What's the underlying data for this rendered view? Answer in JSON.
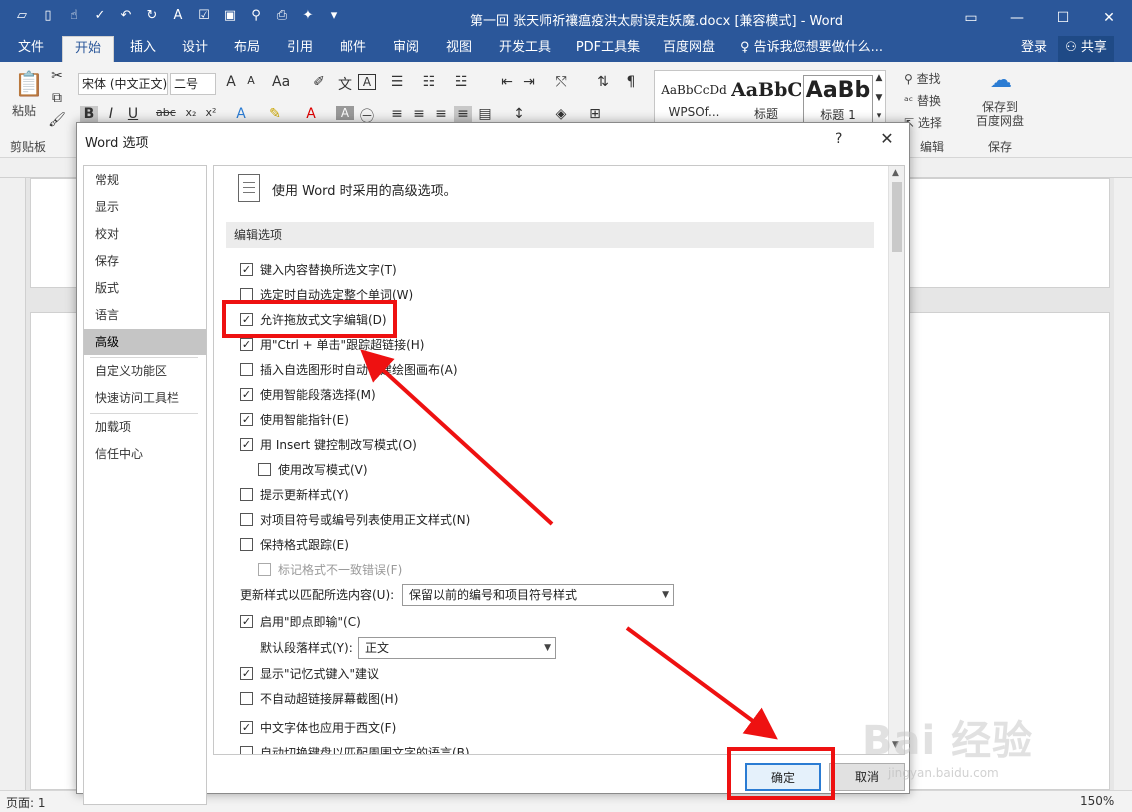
{
  "window": {
    "title": "第一回 张天师祈禳瘟疫洪太尉误走妖魔.docx [兼容模式] - Word",
    "controls": [
      "restore-ribbon-icon",
      "minimize-icon",
      "maximize-icon",
      "close-icon"
    ]
  },
  "quick_access": [
    "folder-icon",
    "new-document-icon",
    "touch-mode-icon",
    "spelling-icon",
    "undo-icon",
    "redo-icon",
    "font-size-icon",
    "checkbox-icon",
    "save-icon",
    "find-icon",
    "print-preview-icon",
    "format-icon",
    "customize-qat-icon"
  ],
  "tabs": [
    "文件",
    "开始",
    "插入",
    "设计",
    "布局",
    "引用",
    "邮件",
    "审阅",
    "视图",
    "开发工具",
    "PDF工具集",
    "百度网盘"
  ],
  "active_tab": "开始",
  "tell_me": "告诉我您想要做什么...",
  "account": {
    "login": "登录",
    "share": "共享"
  },
  "ribbon": {
    "paste": "粘贴",
    "clipboard": "剪贴板",
    "font_name": "宋体 (中文正文)",
    "font_size": "二号",
    "styles": [
      {
        "preview": "AaBbCcDd",
        "name": "WPSOf..."
      },
      {
        "preview": "AaBbC",
        "name": "标题"
      },
      {
        "preview": "AaBb",
        "name": "标题 1"
      }
    ],
    "find": "查找",
    "replace": "替换",
    "select": "选择",
    "editing_group": "编辑",
    "save_to_baidu": "保存到\n百度网盘",
    "save_group": "保存"
  },
  "dialog": {
    "title": "Word 选项",
    "help": "?",
    "close": "✕",
    "nav": [
      "常规",
      "显示",
      "校对",
      "保存",
      "版式",
      "语言",
      "高级",
      "自定义功能区",
      "快速访问工具栏",
      "加载项",
      "信任中心"
    ],
    "nav_selected": "高级",
    "header": "使用 Word 时采用的高级选项。",
    "section": "编辑选项",
    "options": [
      {
        "label": "键入内容替换所选文字(T)",
        "checked": true
      },
      {
        "label": "选定时自动选定整个单词(W)",
        "checked": false
      },
      {
        "label": "允许拖放式文字编辑(D)",
        "checked": true
      },
      {
        "label": "用\"Ctrl + 单击\"跟踪超链接(H)",
        "checked": true
      },
      {
        "label": "插入自选图形时自动创建绘图画布(A)",
        "checked": false
      },
      {
        "label": "使用智能段落选择(M)",
        "checked": true
      },
      {
        "label": "使用智能指针(E)",
        "checked": true
      },
      {
        "label": "用 Insert 键控制改写模式(O)",
        "checked": true
      },
      {
        "label": "使用改写模式(V)",
        "checked": false
      },
      {
        "label": "提示更新样式(Y)",
        "checked": false
      },
      {
        "label": "对项目符号或编号列表使用正文样式(N)",
        "checked": false
      },
      {
        "label": "保持格式跟踪(E)",
        "checked": false
      },
      {
        "label": "标记格式不一致错误(F)",
        "checked": false
      }
    ],
    "update_style_label": "更新样式以匹配所选内容(U):",
    "update_style_value": "保留以前的编号和项目符号样式",
    "click_and_type": {
      "label": "启用\"即点即输\"(C)",
      "checked": true
    },
    "default_para_label": "默认段落样式(Y):",
    "default_para_value": "正文",
    "options2": [
      {
        "label": "显示\"记忆式键入\"建议",
        "checked": true
      },
      {
        "label": "不自动超链接屏幕截图(H)",
        "checked": false
      },
      {
        "label": "中文字体也应用于西文(F)",
        "checked": true
      },
      {
        "label": "自动切换键盘以匹配周围文字的语言(B)",
        "checked": false
      }
    ],
    "ok": "确定",
    "cancel": "取消"
  },
  "status": {
    "page": "页面: 1",
    "zoom": "150%"
  },
  "watermark": {
    "main": "Bai 经验",
    "sub": "jingyan.baidu.com"
  },
  "annotation_color": "#e11111"
}
